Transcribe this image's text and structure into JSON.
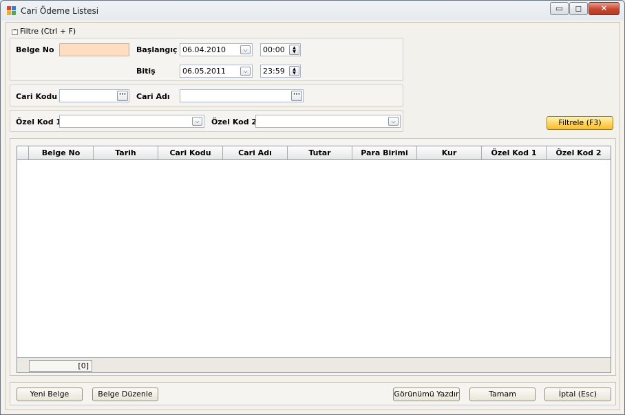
{
  "window": {
    "title": "Cari Ödeme Listesi",
    "minimize": "▭",
    "maximize": "◻",
    "close": "✕"
  },
  "filter": {
    "header": "Filtre (Ctrl + F)",
    "toggle": "^",
    "belge_no_label": "Belge No",
    "belge_no_value": "",
    "baslangic_label": "Başlangıç",
    "baslangic_date": "06.04.2010",
    "baslangic_time": "00:00",
    "bitis_label": "Bitiş",
    "bitis_date": "06.05.2011",
    "bitis_time": "23:59",
    "cari_kodu_label": "Cari Kodu",
    "cari_kodu_value": "",
    "cari_adi_label": "Cari Adı",
    "cari_adi_value": "",
    "ozel_kod1_label": "Özel Kod 1",
    "ozel_kod1_value": "",
    "ozel_kod2_label": "Özel Kod 2",
    "ozel_kod2_value": "",
    "filter_button": "Filtrele (F3)",
    "dropdown_glyph": "⌵",
    "ellipsis_glyph": "···",
    "spin_up": "▲",
    "spin_down": "▼"
  },
  "grid": {
    "columns": [
      "Belge No",
      "Tarih",
      "Cari Kodu",
      "Cari Adı",
      "Tutar",
      "Para Birimi",
      "Kur",
      "Özel Kod 1",
      "Özel Kod 2"
    ],
    "rows": [],
    "row_count": "[0]"
  },
  "buttons": {
    "yeni_belge": "Yeni Belge",
    "belge_duzenle": "Belge Düzenle",
    "gorunumu_yazdir": "Görünümü Yazdır",
    "tamam": "Tamam",
    "iptal": "İptal (Esc)"
  },
  "colors": {
    "accent_button": "#ffd45e",
    "belge_no_field": "#ffddc0",
    "close_button": "#c8452e"
  }
}
